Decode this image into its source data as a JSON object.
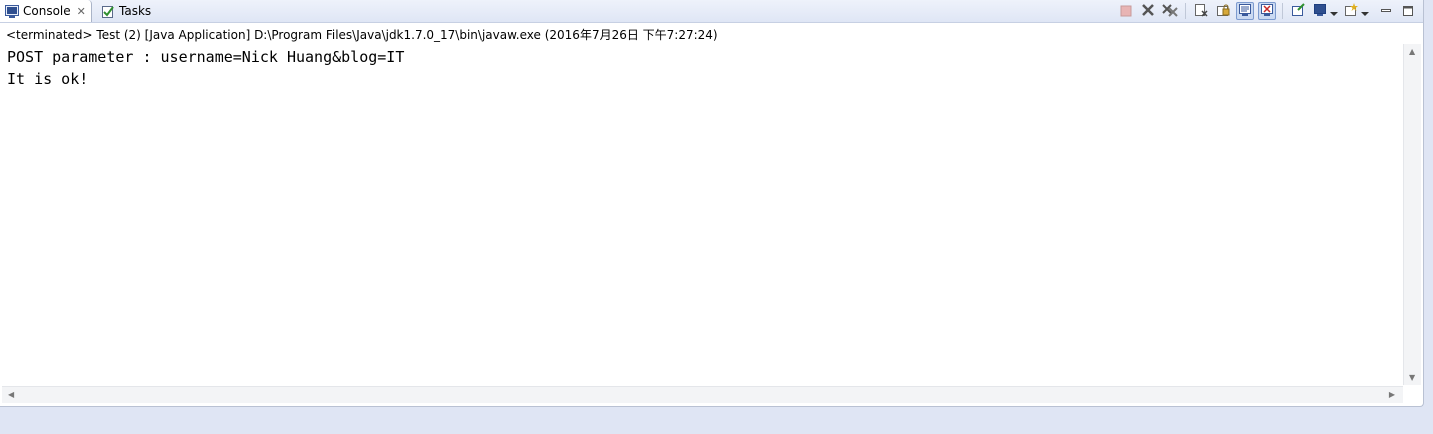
{
  "tabs": [
    {
      "label": "Console",
      "icon": "console-icon",
      "active": true,
      "closable": true
    },
    {
      "label": "Tasks",
      "icon": "tasks-icon",
      "active": false
    }
  ],
  "toolbar": {
    "buttons": [
      {
        "name": "terminate-icon",
        "toggled": false
      },
      {
        "name": "remove-launch-icon",
        "toggled": false
      },
      {
        "name": "remove-all-terminated-icon",
        "toggled": false
      },
      {
        "name": "clear-console-icon",
        "toggled": false
      },
      {
        "name": "scroll-lock-icon",
        "toggled": false
      },
      {
        "name": "show-on-stdout-icon",
        "toggled": true
      },
      {
        "name": "show-on-stderr-icon",
        "toggled": true
      },
      {
        "name": "pin-console-icon",
        "toggled": false
      },
      {
        "name": "display-console-icon",
        "toggled": false
      },
      {
        "name": "new-console-icon",
        "toggled": false
      },
      {
        "name": "minimize-icon",
        "toggled": false
      },
      {
        "name": "maximize-icon",
        "toggled": false
      }
    ]
  },
  "status": "<terminated> Test (2) [Java Application] D:\\Program Files\\Java\\jdk1.7.0_17\\bin\\javaw.exe (2016年7月26日 下午7:27:24)",
  "output": {
    "lines": [
      "POST parameter : username=Nick Huang&blog=IT",
      "It is ok!"
    ]
  },
  "colors": {
    "accent": "#cbdaf2",
    "background": "#dfe5f4"
  }
}
